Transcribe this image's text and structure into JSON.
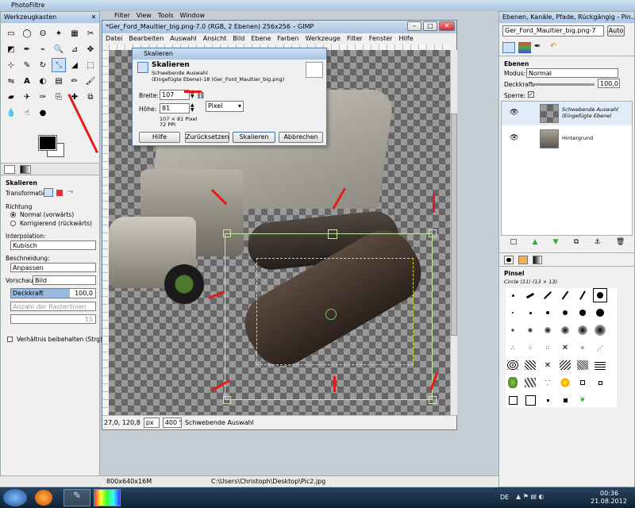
{
  "photofiltre": {
    "title": "PhotoFiltre"
  },
  "toolbox": {
    "title": "Werkzeugkasten",
    "options_title": "Skalieren",
    "transformation_label": "Transformation:",
    "richtung_label": "Richtung",
    "radio_normal": "Normal (vorwärts)",
    "radio_korrigierend": "Korrigierend (rückwärts)",
    "interpolation_label": "Interpolation:",
    "interpolation_value": "Kubisch",
    "beschneidung_label": "Beschneidung:",
    "beschneidung_value": "Anpassen",
    "vorschau_label": "Vorschau:",
    "vorschau_value": "Bild",
    "deckkraft_label": "Deckkraft",
    "deckkraft_value": "100,0",
    "raster_value": "Anzahl der Rasterlinien",
    "raster_number": "15",
    "aspect_label": "Verhältnis beibehalten (Strg)"
  },
  "gimp_window": {
    "title": "*Ger_Ford_Maultier_big.png-7.0 (RGB, 2 Ebenen) 256x256 – GIMP",
    "menu": [
      "Datei",
      "Bearbeiten",
      "Auswahl",
      "Ansicht",
      "Bild",
      "Ebene",
      "Farben",
      "Werkzeuge",
      "Filter",
      "Fenster",
      "Hilfe"
    ],
    "coords": "27,0, 120,8",
    "unit": "px",
    "zoom": "400 %",
    "status": "Schwebende Auswahl"
  },
  "bg_menu": [
    "Filter",
    "View",
    "Tools",
    "Window"
  ],
  "scale_dialog": {
    "title": "Skalieren",
    "heading": "Skalieren",
    "sub1": "Schwebende Auswahl",
    "sub2": "(Eingefügte Ebene)-18 (Ger_Ford_Maultier_big.png)",
    "breite_label": "Breite:",
    "breite_value": "107",
    "hoehe_label": "Höhe:",
    "hoehe_value": "81",
    "info1": "107 × 81 Pixel",
    "info2": "72 PPI",
    "unit": "Pixel",
    "buttons": {
      "hilfe": "Hilfe",
      "reset": "Zurücksetzen",
      "ok": "Skalieren",
      "cancel": "Abbrechen"
    }
  },
  "layers": {
    "title": "Ebenen, Kanäle, Pfade, Rückgängig - Pin...",
    "image_select": "Ger_Ford_Maultier_big.png-7",
    "auto_btn": "Auto",
    "section": "Ebenen",
    "modus_label": "Modus:",
    "modus_value": "Normal",
    "deckkraft_label": "Deckkraft:",
    "deckkraft_value": "100,0",
    "sperre_label": "Sperre:",
    "items": [
      {
        "name": "Schwebende Auswahl",
        "sub": "(Eingefügte Ebene)"
      },
      {
        "name": "Hintergrund",
        "sub": ""
      }
    ]
  },
  "brushes": {
    "section": "Pinsel",
    "brush_name": "Circle (11) (13 × 13)"
  },
  "bottom_status": {
    "size": "800x640x16M",
    "path": "C:\\Users\\Christoph\\Desktop\\Pic2.jpg"
  },
  "taskbar": {
    "lang": "DE",
    "time": "00:36",
    "date": "21.08.2012"
  },
  "colors": {
    "accent": "#4a7dbd",
    "arrow": "#e51b1b",
    "taskbar": "#1c3651"
  }
}
